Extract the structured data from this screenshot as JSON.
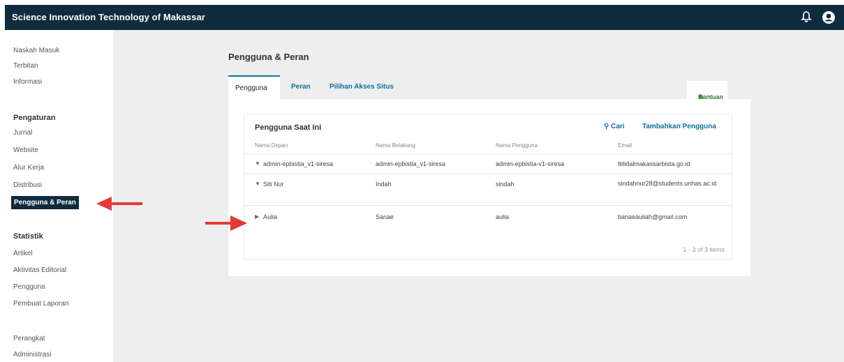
{
  "header": {
    "title": "Science Innovation Technology of Makassar",
    "bell_icon": "bell-icon",
    "user_icon": "user-circle-icon"
  },
  "sidebar": {
    "group1": [
      "Naskah Masuk",
      "Terbitan",
      "Informasi"
    ],
    "settings_heading": "Pengaturan",
    "settings_items": [
      "Jurnal",
      "Website",
      "Alur Kerja",
      "Distribusi",
      "Pengguna & Peran"
    ],
    "stats_heading": "Statistik",
    "stats_items": [
      "Artikel",
      "Aktivitas Editorial",
      "Pengguna",
      "Pembuat Laporan"
    ],
    "tools_items": [
      "Perangkat",
      "Administrasi"
    ]
  },
  "main": {
    "page_title": "Pengguna & Peran",
    "tabs": [
      "Pengguna",
      "Peran",
      "Pilihan Akses Situs"
    ],
    "help_label": "Bantuan",
    "grid": {
      "title": "Pengguna Saat Ini",
      "search_label": "Cari",
      "add_label": "Tambahkan Pengguna",
      "columns": [
        "Nama Depan",
        "Nama Belakang",
        "Nama Pengguna",
        "Email"
      ],
      "rows": [
        [
          "admin-epbistia_v1-siresa",
          "admin-epbistia_v1-siresa",
          "admin-epbistia-v1-siresa",
          "ttitidalmakassarbista.go.id"
        ],
        [
          "Siti Nur",
          "Indah",
          "sindah",
          "sindahnur28@students.unhas.ac.id"
        ],
        [
          "Aulia",
          "Sanae",
          "aulia",
          "banaeauliah@gmail.com"
        ]
      ],
      "pager": "1 - 3 of 3 items"
    }
  },
  "colors": {
    "header_bg": "#0f2b3d",
    "link": "#0f6fa0",
    "arrow": "#e53935"
  }
}
